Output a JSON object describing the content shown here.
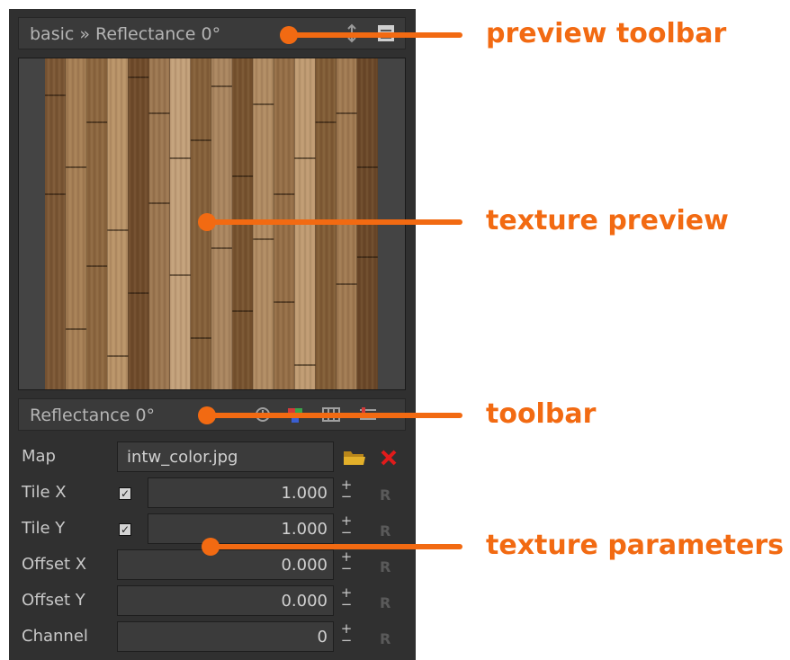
{
  "preview_toolbar": {
    "breadcrumb": "basic » Reflectance 0°"
  },
  "toolbar": {
    "label": "Reflectance 0°"
  },
  "params": {
    "map": {
      "label": "Map",
      "value": "intw_color.jpg"
    },
    "tile_x": {
      "label": "Tile X",
      "value": "1.000",
      "checked": true
    },
    "tile_y": {
      "label": "Tile Y",
      "value": "1.000",
      "checked": true
    },
    "offset_x": {
      "label": "Offset X",
      "value": "0.000"
    },
    "offset_y": {
      "label": "Offset Y",
      "value": "0.000"
    },
    "channel": {
      "label": "Channel",
      "value": "0"
    },
    "reset_label": "R",
    "plus": "+",
    "minus": "−"
  },
  "annotations": {
    "preview_toolbar": "preview toolbar",
    "texture_preview": "texture preview",
    "toolbar": "toolbar",
    "texture_parameters": "texture parameters"
  },
  "colors": {
    "accent": "#f26a12",
    "panel": "#303030",
    "delete": "#e01b1b",
    "folder": "#d9a520"
  }
}
